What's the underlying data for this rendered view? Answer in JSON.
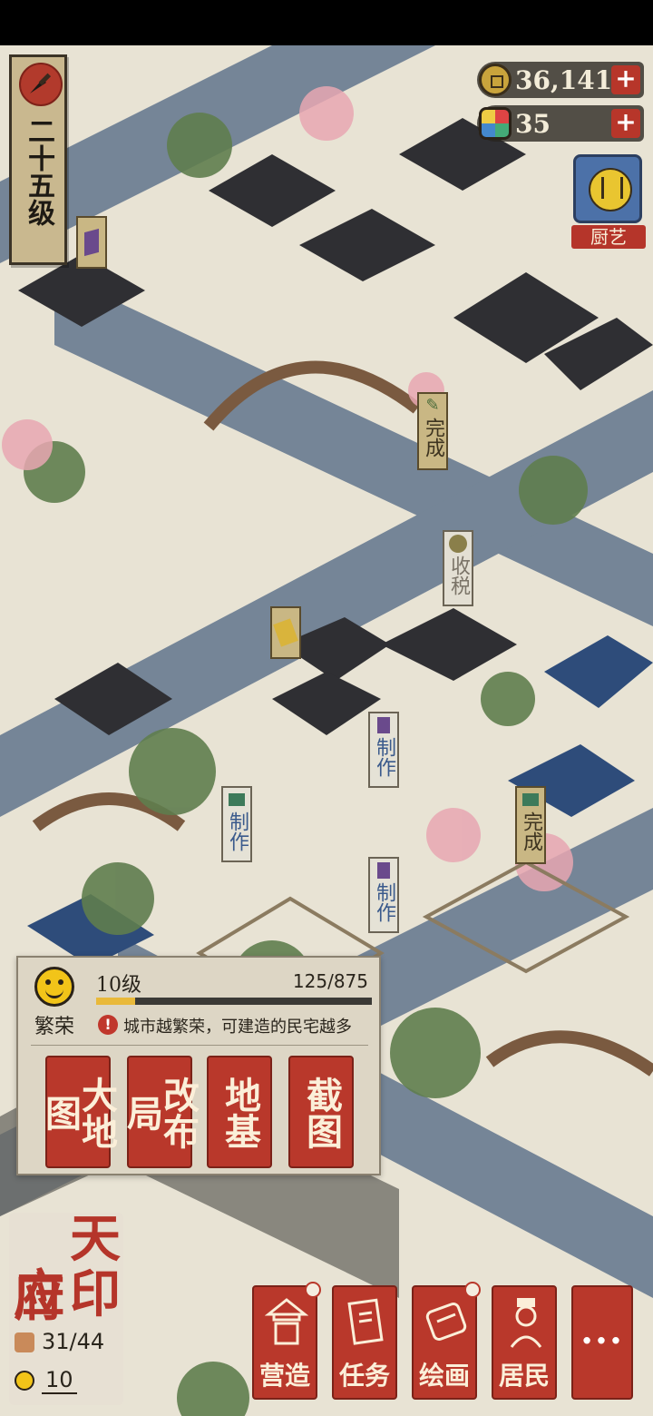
{
  "player": {
    "level_text": "二十五级"
  },
  "currency": {
    "coins": "36,141",
    "gems": "35",
    "add_symbol": "+"
  },
  "chef_badge": {
    "label": "厨艺"
  },
  "map_tags": {
    "done_1": "完成",
    "tax": "收税",
    "make_1": "制作",
    "make_2": "制作",
    "make_3": "制作",
    "done_2": "完成"
  },
  "prosperity": {
    "label": "繁荣",
    "level": "10级",
    "progress_text": "125/875",
    "progress_fraction": 0.143,
    "hint": "城市越繁荣，可建造的民宅越多",
    "hint_icon": "!"
  },
  "actions": {
    "world_map": "大地图",
    "relayout": "改布局",
    "foundation": "地基",
    "screenshot": "截图"
  },
  "city": {
    "name": "应天府印",
    "name_chars": [
      "应",
      "天",
      "府",
      "印"
    ],
    "population": "31/44",
    "happiness": "10"
  },
  "nav": {
    "build": "营造",
    "tasks": "任务",
    "paint": "绘画",
    "residents": "居民",
    "more": "···"
  },
  "colors": {
    "accent_red": "#b9382b",
    "paper": "#ddd6c5",
    "water": "#6f8094"
  }
}
